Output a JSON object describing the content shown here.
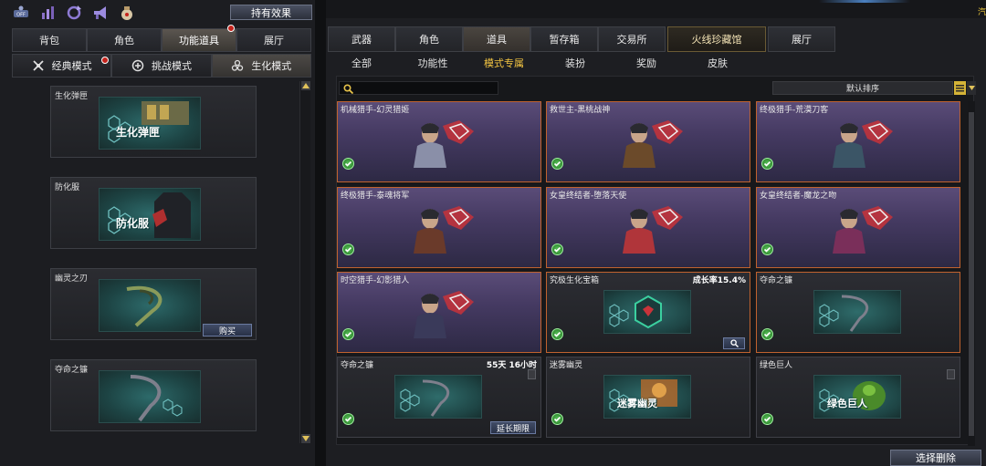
{
  "left": {
    "top_icons": [
      "off-toggle-icon",
      "stats-icon",
      "refresh-icon",
      "megaphone-icon",
      "lucky-bag-icon"
    ],
    "off_label": "OFF",
    "effects_button": "持有效果",
    "tabs": [
      {
        "label": "背包",
        "active": false
      },
      {
        "label": "角色",
        "active": false
      },
      {
        "label": "功能道具",
        "active": true
      },
      {
        "label": "展厅",
        "active": false
      }
    ],
    "modes": [
      {
        "label": "经典模式",
        "active": false
      },
      {
        "label": "挑战模式",
        "active": false
      },
      {
        "label": "生化模式",
        "active": true
      }
    ],
    "items": [
      {
        "name": "生化弹匣",
        "art_label": "生化弹匣",
        "button": ""
      },
      {
        "name": "防化服",
        "art_label": "防化服",
        "button": ""
      },
      {
        "name": "幽灵之刃",
        "art_label": "",
        "button": "购买"
      },
      {
        "name": "夺命之镰",
        "art_label": "",
        "button": ""
      }
    ]
  },
  "right": {
    "corner_text": "汽",
    "tabs": [
      "武器",
      "角色",
      "道具",
      "暂存箱",
      "交易所",
      "火线珍藏馆",
      "展厅"
    ],
    "active_tab": 2,
    "special_tab": 5,
    "subtabs": [
      "全部",
      "功能性",
      "模式专属",
      "装扮",
      "奖励",
      "皮肤"
    ],
    "active_subtab": 2,
    "search_placeholder": "",
    "sort_label": "默认排序",
    "delete_button": "选择删除",
    "cards": [
      {
        "name": "机械猎手-幻灵猎姬",
        "style": "hero",
        "tag": "",
        "art": "portrait",
        "art_label": "",
        "button": "",
        "trash": false
      },
      {
        "name": "救世主-黑桃战神",
        "style": "hero",
        "tag": "",
        "art": "portrait",
        "art_label": "",
        "button": "",
        "trash": false
      },
      {
        "name": "终极猎手-荒漠刀客",
        "style": "hero",
        "tag": "",
        "art": "portrait",
        "art_label": "",
        "button": "",
        "trash": false
      },
      {
        "name": "终极猎手-泰魂将军",
        "style": "hero",
        "tag": "",
        "art": "portrait",
        "art_label": "",
        "button": "",
        "trash": false
      },
      {
        "name": "女皇终结者-堕落天使",
        "style": "hero",
        "tag": "",
        "art": "portrait",
        "art_label": "",
        "button": "",
        "trash": false
      },
      {
        "name": "女皇终结者-魔龙之吻",
        "style": "hero",
        "tag": "",
        "art": "portrait",
        "art_label": "",
        "button": "",
        "trash": false
      },
      {
        "name": "时空猎手-幻影猎人",
        "style": "hero",
        "tag": "",
        "art": "portrait",
        "art_label": "",
        "button": "",
        "trash": false
      },
      {
        "name": "究极生化宝箱",
        "style": "dark",
        "tag": "成长率15.4%",
        "art": "box",
        "art_label": "",
        "button": "magnify",
        "trash": false
      },
      {
        "name": "夺命之镰",
        "style": "dark",
        "tag": "",
        "art": "box",
        "art_label": "",
        "button": "",
        "trash": false
      },
      {
        "name": "夺命之镰",
        "style": "plain",
        "tag": "55天 16小时",
        "art": "box",
        "art_label": "",
        "button": "延长期限",
        "trash": true
      },
      {
        "name": "迷雾幽灵",
        "style": "plain",
        "tag": "",
        "art": "box",
        "art_label": "迷雾幽灵",
        "button": "",
        "trash": false
      },
      {
        "name": "绿色巨人",
        "style": "plain",
        "tag": "",
        "art": "box",
        "art_label": "绿色巨人",
        "button": "",
        "trash": true
      }
    ]
  }
}
